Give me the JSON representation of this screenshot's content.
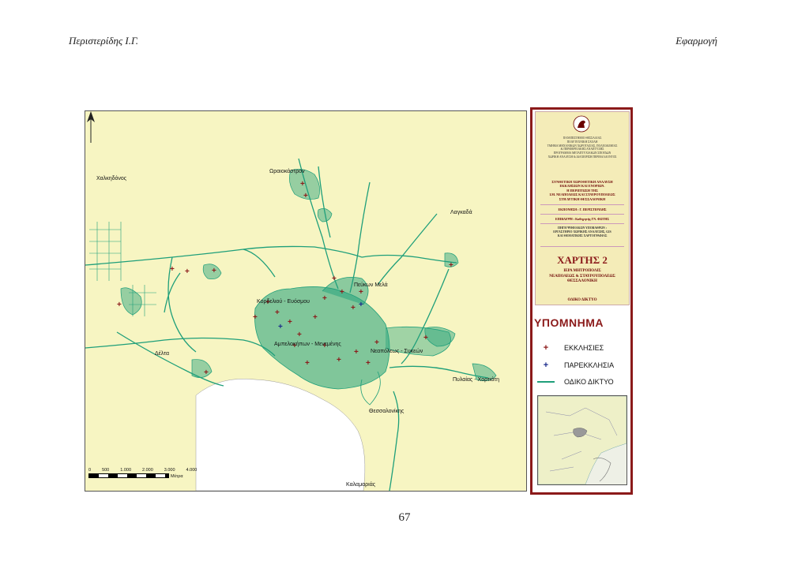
{
  "header": {
    "left": "Περιστερίδης Ι.Γ.",
    "right": "Εφαρμογή"
  },
  "page_number": "67",
  "map": {
    "places": [
      {
        "name": "Χαλκηδόνος"
      },
      {
        "name": "Ωραιοκάστρον"
      },
      {
        "name": "Λαγκαδά"
      },
      {
        "name": "Πεύκων Μελά"
      },
      {
        "name": "Κορδελιού - Ευόσμου"
      },
      {
        "name": "Αμπελοκήπων - Μενεμένης"
      },
      {
        "name": "Δέλτα"
      },
      {
        "name": "Νεαπόλεως - Συκεών"
      },
      {
        "name": "Πυλαίας - Χορτιάτη"
      },
      {
        "name": "Θεσσαλονίκης"
      },
      {
        "name": "Καλαμαριάς"
      }
    ],
    "scale": {
      "ticks": [
        "0",
        "500",
        "1.000",
        "2.000",
        "3.000",
        "4.000"
      ],
      "unit": "Μέτρα"
    },
    "colors": {
      "land": "#f7f5c2",
      "sea": "#ffffff",
      "network": "#1f9f7a",
      "church": "#8b1a1a",
      "chapel": "#1a2a8b"
    }
  },
  "panel": {
    "university_lines": [
      "ΠΑΝΕΠΙΣΤΗΜΙΟ ΘΕΣΣΑΛΙΑΣ",
      "ΠΟΛΥΤΕΧΝΙΚΗ ΣΧΟΛΗ",
      "ΤΜΗΜΑ ΜΗΧΑΝΙΚΩΝ ΧΩΡΟΤΑΞΙΑΣ, ΠΟΛΕΟΔΟΜΙΑΣ",
      "& ΠΕΡΙΦΕΡΕΙΑΚΗΣ ΑΝΑΠΤΥΞΗΣ",
      "ΠΡΟΓΡΑΜΜΑ ΜΕΤΑΠΤΥΧΙΑΚΩΝ ΣΠΟΥΔΩΝ",
      "ΧΩΡΙΚΗ ΑΝΑΛΥΣΗ & ΔΙΑΧΕΙΡΙΣΗ ΠΕΡΙΒΑΛΛΟΝΤΟΣ"
    ],
    "study_lines": [
      "ΣΥΝΘΕΤΙΚΗ ΧΩΡΟΘΕΤΙΚΗ ΑΝΑΛΥΣΗ",
      "ΕΚΚΛΗΣΙΩΝ ΚΑΙ ΕΝΟΡΙΩΝ.",
      "Η ΠΕΡΙΠΤΩΣΗ ΤΗΣ",
      "Ι.Μ. ΝΕΑΠΟΛΕΩΣ ΚΑΙ ΣΤΑΥΡΟΥΠΟΛΕΩΣ",
      "ΣΤΗ ΔΥΤΙΚΗ ΘΕΣΣΑΛΟΝΙΚΗ"
    ],
    "prepared_by": "ΕΚΠΟΝΗΣΗ : Γ. ΠΕΡΙΣΤΕΡΙΔΗΣ",
    "supervisor": "ΕΠΙΒΛΕΨΗ : Καθηγητής ΓΝ. ΦΩΤΗΣ",
    "source_lines": [
      "ΠΗΓΗ ΨΗΦΙΑΚΩΝ ΥΠΟΒΑΘΡΩΝ :",
      "ΕΡΓΑΣΤΗΡΙΟ ΧΩΡΙΚΗΣ ΑΝΑΛΥΣΗΣ, GIS",
      "ΚΑΙ ΘΕΜΑΤΙΚΗΣ ΧΑΡΤΟΓΡΑΦΙΑΣ"
    ],
    "map_title": "ΧΑΡΤΗΣ 2",
    "map_subtitle_lines": [
      "ΙΕΡΑ ΜΗΤΡΟΠΟΛΙΣ",
      "ΝΕΑΠΟΛΕΩΣ & ΣΤΑΥΡΟΥΠΟΛΕΩΣ",
      "ΘΕΣΣΑΛΟΝΙΚΗ"
    ],
    "map_network": "ΟΔΙΚΟ ΔΙΚΤΥΟ",
    "legend_title": "ΥΠΟΜΝΗΜΑ",
    "legend": [
      {
        "label": "ΕΚΚΛΗΣΙΕΣ",
        "symbol": "+"
      },
      {
        "label": "ΠΑΡΕΚΚΛΗΣΙΑ",
        "symbol": "+"
      },
      {
        "label": "ΟΔΙΚΟ ΔΙΚΤΥΟ",
        "symbol": "line"
      }
    ]
  }
}
